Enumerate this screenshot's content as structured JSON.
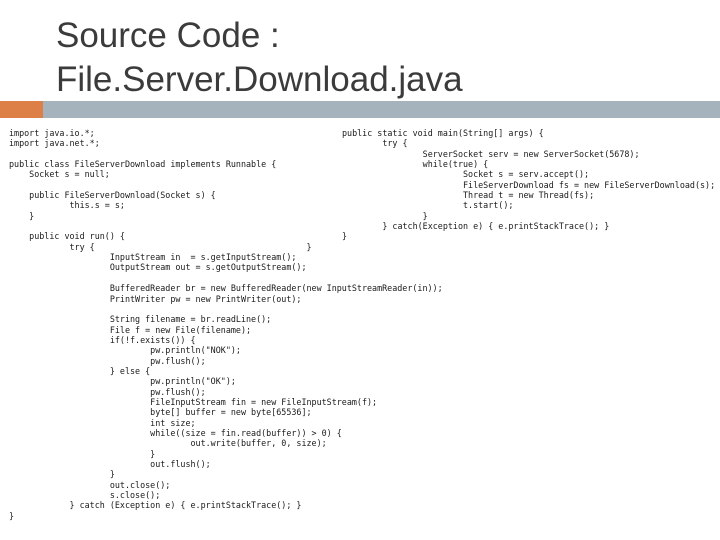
{
  "slide": {
    "title_line1": "Source Code :",
    "title_line2": "File.Server.Download.java"
  },
  "colors": {
    "accent": "#dd8047",
    "header_bar": "#a5b3bd",
    "title_text": "#3b3b3b",
    "code_text": "#1a1a1a"
  },
  "code": {
    "left_column": [
      "import java.io.*;",
      "import java.net.*;",
      "",
      "public class FileServerDownload implements Runnable {",
      "    Socket s = null;",
      "",
      "    public FileServerDownload(Socket s) {",
      "            this.s = s;",
      "    }",
      "",
      "    public void run() {",
      "            try {                                          }",
      "                    InputStream in  = s.getInputStream();",
      "                    OutputStream out = s.getOutputStream();",
      "",
      "                    BufferedReader br = new BufferedReader(new InputStreamReader(in));",
      "                    PrintWriter pw = new PrintWriter(out);",
      "",
      "                    String filename = br.readLine();",
      "                    File f = new File(filename);",
      "                    if(!f.exists()) {",
      "                            pw.println(\"NOK\");",
      "                            pw.flush();",
      "                    } else {",
      "                            pw.println(\"OK\");",
      "                            pw.flush();",
      "                            FileInputStream fin = new FileInputStream(f);",
      "                            byte[] buffer = new byte[65536];",
      "                            int size;",
      "                            while((size = fin.read(buffer)) > 0) {",
      "                                    out.write(buffer, 0, size);",
      "                            }",
      "                            out.flush();",
      "                    }",
      "                    out.close();",
      "                    s.close();",
      "            } catch (Exception e) { e.printStackTrace(); }",
      "}"
    ],
    "right_column": [
      "public static void main(String[] args) {",
      "        try {",
      "                ServerSocket serv = new ServerSocket(5678);",
      "                while(true) {",
      "                        Socket s = serv.accept();",
      "                        FileServerDownload fs = new FileServerDownload(s);",
      "                        Thread t = new Thread(fs);",
      "                        t.start();",
      "                }",
      "        } catch(Exception e) { e.printStackTrace(); }",
      "}"
    ]
  }
}
